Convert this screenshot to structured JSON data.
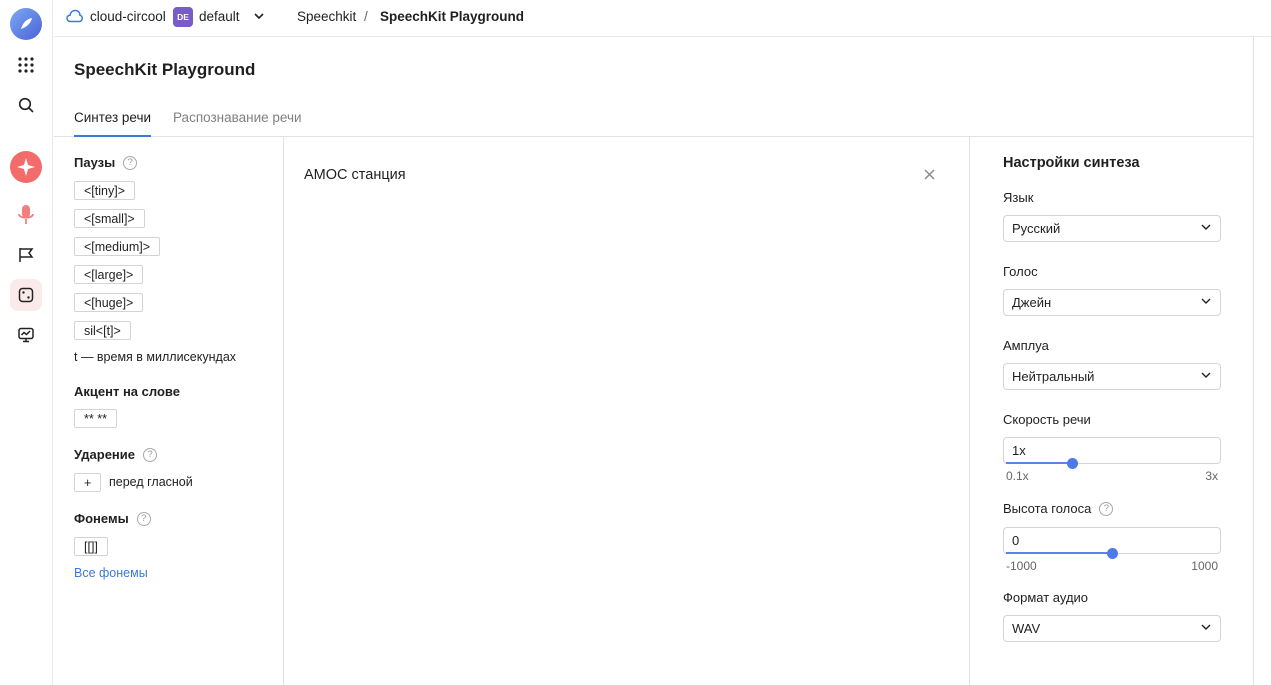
{
  "rail": {
    "items": [
      "logo",
      "apps",
      "search",
      "assistant",
      "speechkit",
      "flags",
      "playground",
      "monitoring"
    ]
  },
  "topbar": {
    "cloud_name": "cloud-circool",
    "folder_badge": "DE",
    "folder_name": "default",
    "breadcrumb_service": "Speechkit",
    "breadcrumb_separator": "/",
    "breadcrumb_page": "SpeechKit Playground"
  },
  "page": {
    "title": "SpeechKit Playground",
    "tabs": [
      {
        "label": "Синтез речи",
        "active": true
      },
      {
        "label": "Распознавание речи",
        "active": false
      }
    ]
  },
  "markup_panel": {
    "pauses_title": "Паузы",
    "pauses": [
      "<[tiny]>",
      "<[small]>",
      "<[medium]>",
      "<[large]>",
      "<[huge]>",
      "sil<[t]>"
    ],
    "pauses_note": "t — время в миллисекундах",
    "accent_title": "Акцент на слове",
    "accent_chip": "** **",
    "stress_title": "Ударение",
    "stress_chip": "+",
    "stress_note": "перед гласной",
    "phonemes_title": "Фонемы",
    "phonemes_chip": "[[]]",
    "phonemes_link": "Все фонемы",
    "help_glyph": "?"
  },
  "editor": {
    "text": "АМОС станция"
  },
  "settings": {
    "title": "Настройки синтеза",
    "language_label": "Язык",
    "language_value": "Русский",
    "voice_label": "Голос",
    "voice_value": "Джейн",
    "role_label": "Амплуа",
    "role_value": "Нейтральный",
    "speed_label": "Скорость речи",
    "speed_value": "1x",
    "speed_min": "0.1x",
    "speed_max": "3x",
    "speed_fraction": 0.31,
    "pitch_label": "Высота голоса",
    "pitch_value": "0",
    "pitch_min": "-1000",
    "pitch_max": "1000",
    "pitch_fraction": 0.5,
    "format_label": "Формат аудио",
    "format_value": "WAV"
  },
  "colors": {
    "accent": "#3a7bd5",
    "slider": "#4d7be6",
    "badge": "#7a5cc6",
    "assistant": "#f26c6c"
  }
}
